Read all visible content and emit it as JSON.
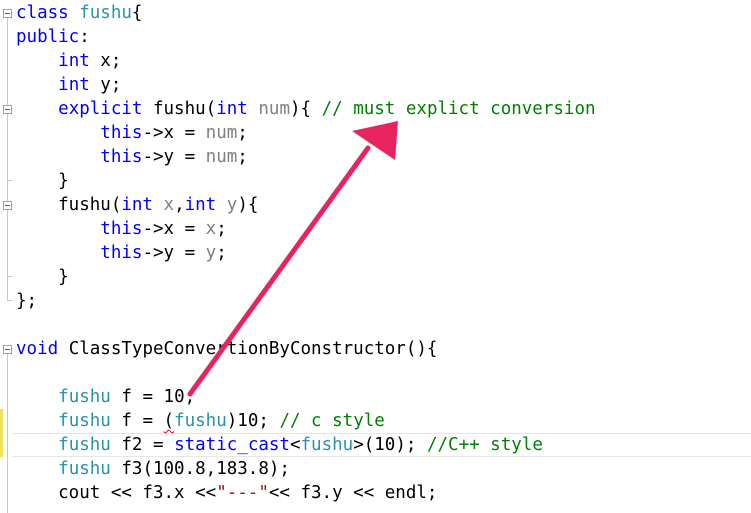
{
  "code": {
    "l1": [
      "class",
      " ",
      "fushu",
      "{"
    ],
    "l2": [
      "public",
      ":"
    ],
    "l3": [
      "    ",
      "int",
      " x;"
    ],
    "l4": [
      "    ",
      "int",
      " y;"
    ],
    "l5": [
      "    ",
      "explicit",
      " fushu(",
      "int",
      " ",
      "num",
      "){ ",
      "// must explict conversion"
    ],
    "l6": [
      "        ",
      "this",
      "->x = ",
      "num",
      ";"
    ],
    "l7": [
      "        ",
      "this",
      "->y = ",
      "num",
      ";"
    ],
    "l8": [
      "    }"
    ],
    "l9": [
      "    fushu(",
      "int",
      " ",
      "x",
      ",",
      "int",
      " ",
      "y",
      "){"
    ],
    "l10": [
      "        ",
      "this",
      "->x = ",
      "x",
      ";"
    ],
    "l11": [
      "        ",
      "this",
      "->y = ",
      "y",
      ";"
    ],
    "l12": [
      "    }"
    ],
    "l13": [
      "};"
    ],
    "l14": [
      ""
    ],
    "l15": [
      "void",
      " ClassTypeConvertionByConstructor(){"
    ],
    "l16": [
      ""
    ],
    "l17": [
      "    ",
      "fushu",
      " f = ",
      "10",
      ";"
    ],
    "l18": [
      "    ",
      "fushu",
      " f = ",
      "(",
      "fushu",
      ")10; ",
      "// c style"
    ],
    "l19": [
      "    ",
      "fushu",
      " f2 = ",
      "static_cast",
      "<",
      "fushu",
      ">(10); ",
      "//C++ style"
    ],
    "l20": [
      "    ",
      "fushu",
      " f3(100.8,183.8);"
    ],
    "l21": [
      "    cout << f3.x <<",
      "\"---\"",
      "<< f3.y << endl;"
    ]
  },
  "colors": {
    "keyword": "#0000ff",
    "type": "#2b91af",
    "comment": "#008000",
    "parameter": "#808080",
    "string": "#a31515",
    "arrow": "#e8245e"
  },
  "annotation": {
    "icon": "arrow-icon"
  }
}
